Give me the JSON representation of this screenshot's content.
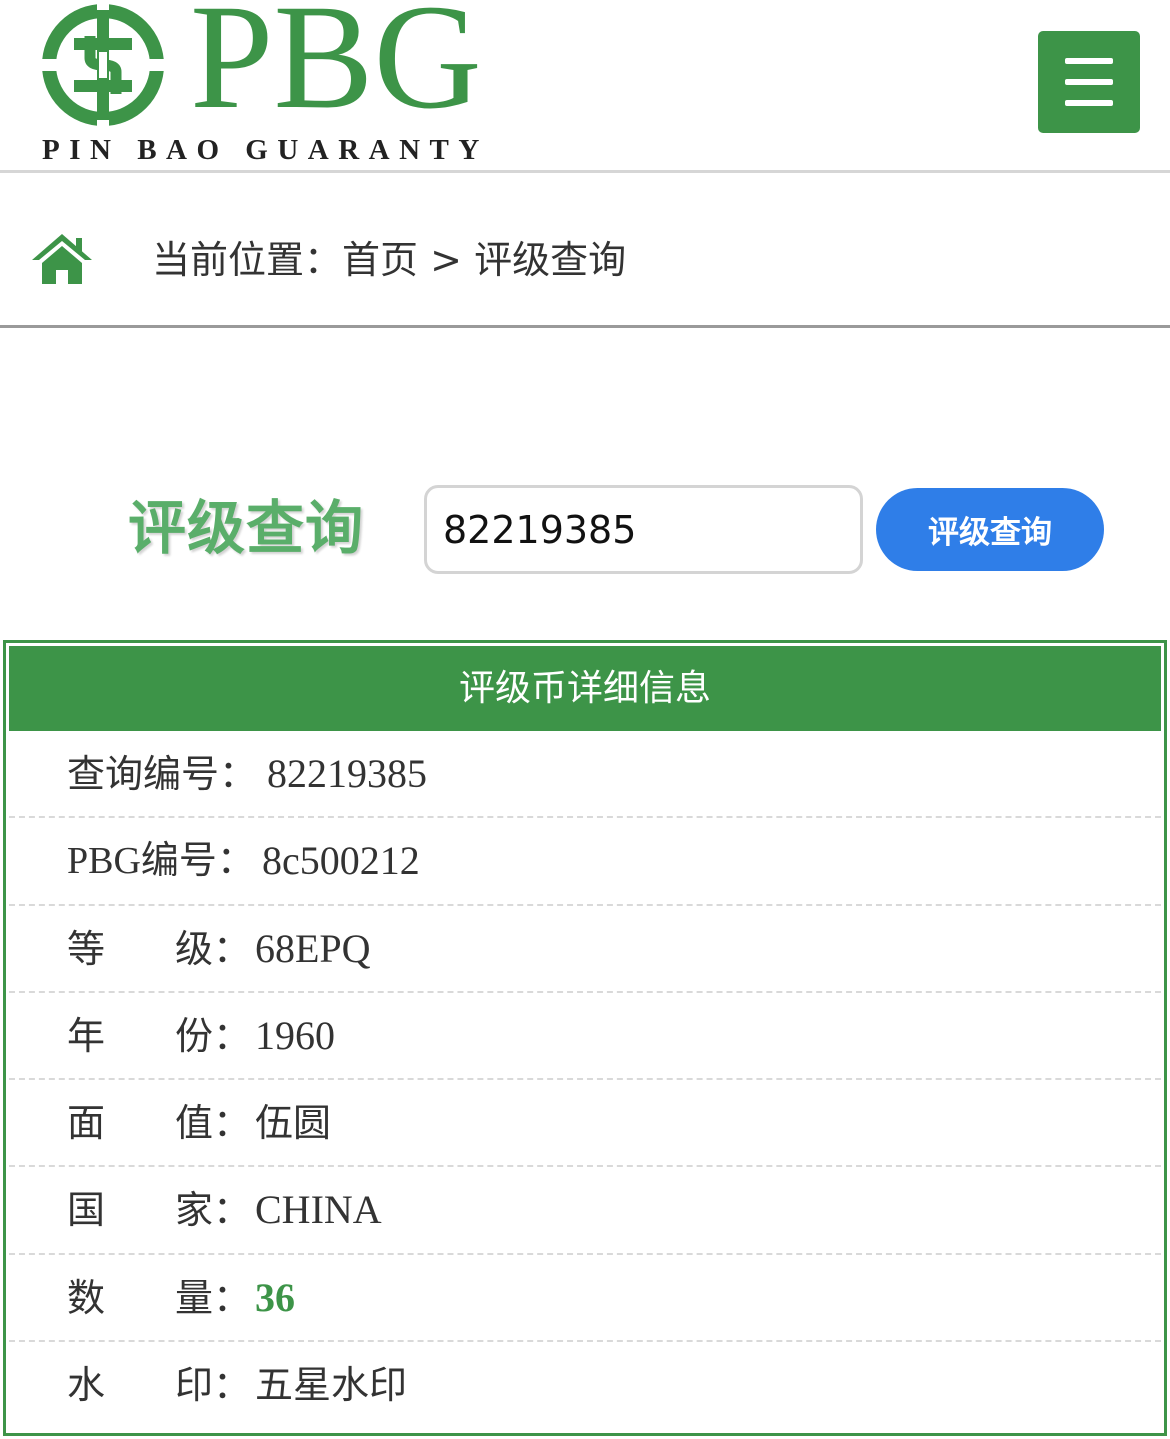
{
  "header": {
    "logo_mark": "PBG",
    "logo_subtitle": "PIN BAO GUARANTY",
    "brand_color": "#3d9448"
  },
  "breadcrumb": {
    "prefix": "当前位置：",
    "home": "首页",
    "separator": ">",
    "current": "评级查询"
  },
  "search": {
    "title": "评级查询",
    "input_value": "82219385",
    "button_label": "评级查询",
    "button_color": "#2f7ee8"
  },
  "detail": {
    "heading": "评级币详细信息",
    "rows": [
      {
        "label": "查询编号：",
        "value": "82219385"
      },
      {
        "label": "PBG编号：",
        "value": "8c500212"
      },
      {
        "label_a": "等",
        "label_b": "级：",
        "value": "68EPQ"
      },
      {
        "label_a": "年",
        "label_b": "份：",
        "value": "1960"
      },
      {
        "label_a": "面",
        "label_b": "值：",
        "value": "伍圆"
      },
      {
        "label_a": "国",
        "label_b": "家：",
        "value": "CHINA"
      },
      {
        "label_a": "数",
        "label_b": "量：",
        "value": "36"
      },
      {
        "label_a": "水",
        "label_b": "印：",
        "value": "五星水印"
      }
    ]
  },
  "icons": {
    "menu": "hamburger-menu-icon",
    "home": "home-icon",
    "logo": "pbg-emblem-logo"
  }
}
